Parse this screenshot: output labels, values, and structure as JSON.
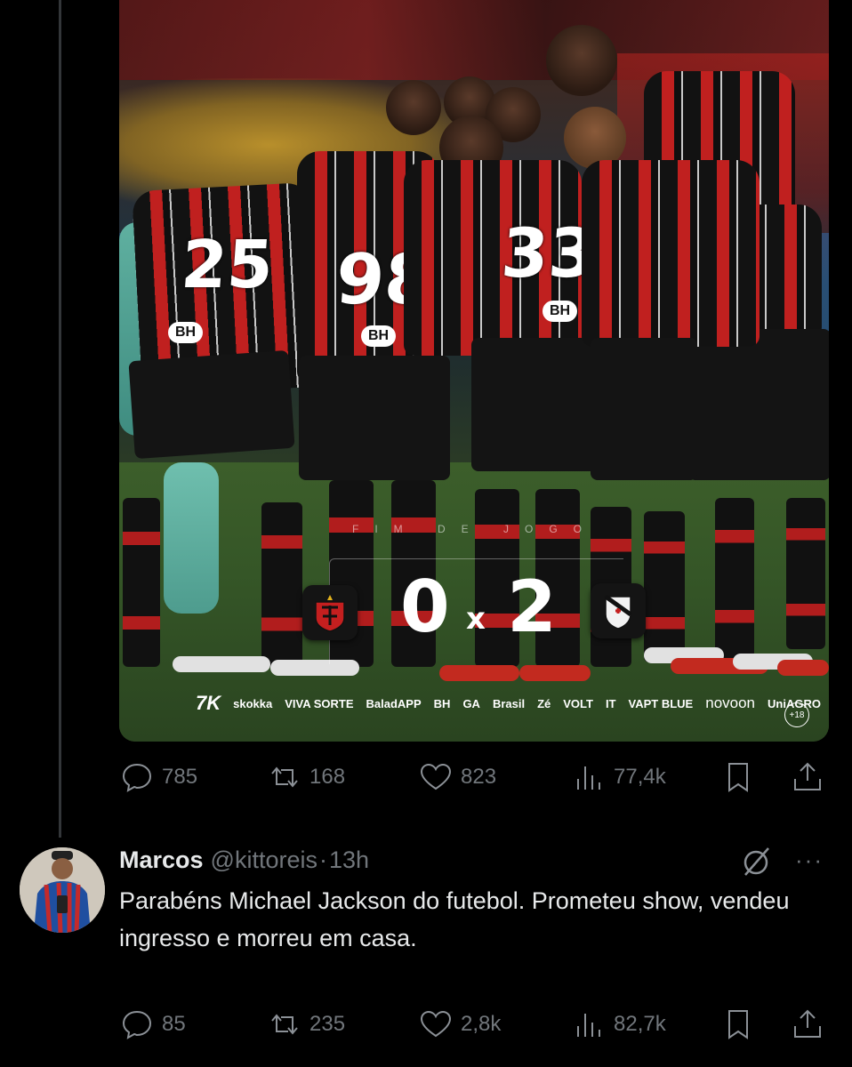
{
  "media": {
    "overlay_title": "FIM DE JOGO",
    "score_home": "0",
    "score_separator": "x",
    "score_away": "2",
    "age_rating": "+18",
    "jersey_numbers": [
      "25",
      "98",
      "33"
    ],
    "jersey_sponsor": "BH",
    "sponsors": [
      "7K",
      "skokka",
      "VIVA SORTE",
      "BaladAPP",
      "BH",
      "GA",
      "Brasil",
      "Zé",
      "VOLT",
      "IT",
      "VAPT BLUE",
      "novoon",
      "UniAGRO"
    ]
  },
  "tweet_actions": {
    "replies": "785",
    "reposts": "168",
    "likes": "823",
    "views": "77,4k"
  },
  "reply": {
    "name": "Marcos",
    "handle": "@kittoreis",
    "separator": "·",
    "time": "13h",
    "text": "Parabéns Michael Jackson do futebol. Prometeu show, vendeu ingresso e morreu em casa.",
    "more": "···",
    "actions": {
      "replies": "85",
      "reposts": "235",
      "likes": "2,8k",
      "views": "82,7k"
    }
  },
  "icons": [
    "reply-icon",
    "repost-icon",
    "like-icon",
    "views-icon",
    "bookmark-icon",
    "share-icon",
    "grok-icon",
    "more-icon"
  ]
}
